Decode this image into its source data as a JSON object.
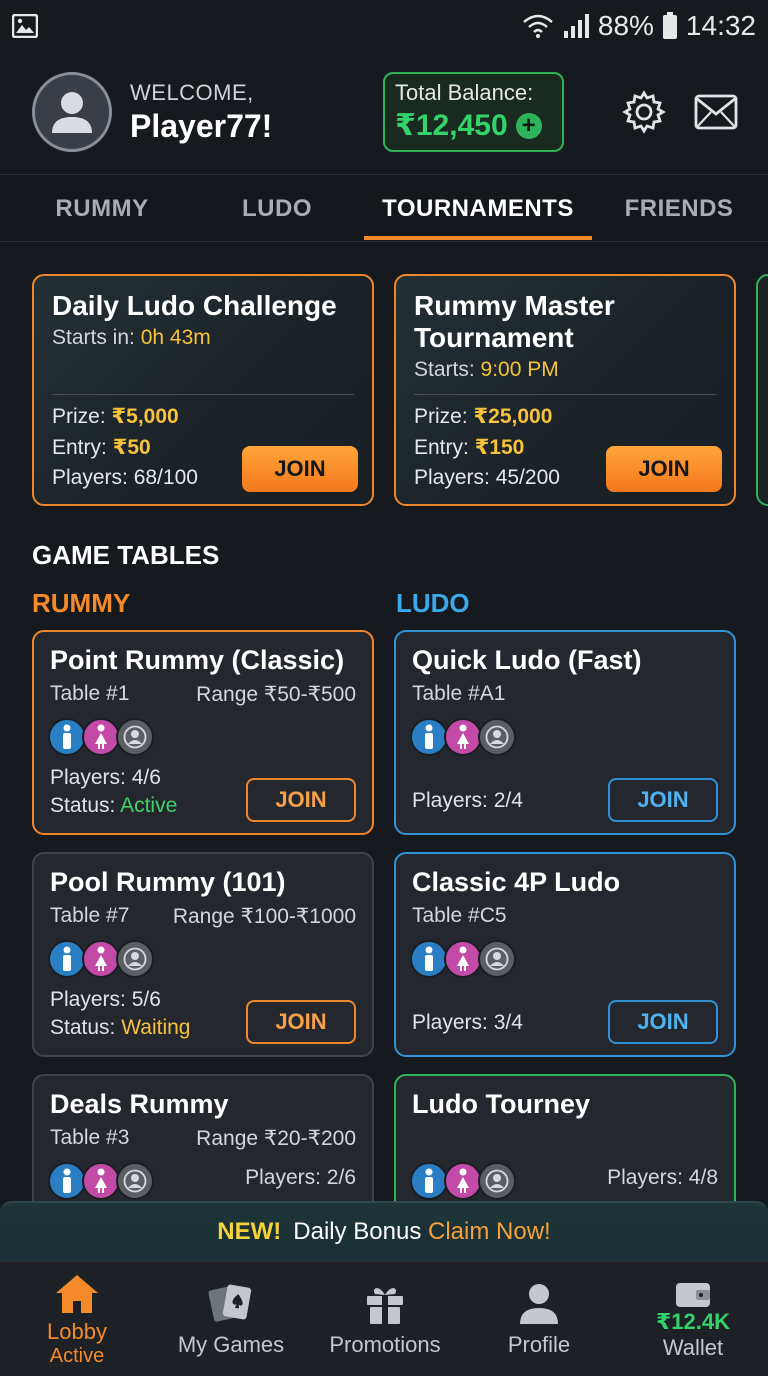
{
  "status_bar": {
    "battery": "88%",
    "time": "14:32"
  },
  "header": {
    "welcome": "WELCOME,",
    "player_name": "Player77!",
    "balance_label": "Total Balance:",
    "balance_amount": "₹12,450"
  },
  "tabs": [
    {
      "label": "RUMMY",
      "active": false
    },
    {
      "label": "LUDO",
      "active": false
    },
    {
      "label": "TOURNAMENTS",
      "active": true
    },
    {
      "label": "FRIENDS",
      "active": false
    }
  ],
  "tournaments": [
    {
      "title": "Daily Ludo Challenge",
      "starts_label": "Starts in:",
      "starts_value": "0h 43m",
      "prize_label": "Prize:",
      "prize": "₹5,000",
      "entry_label": "Entry:",
      "entry": "₹50",
      "players_label": "Players:",
      "players": "68/100",
      "join": "JOIN"
    },
    {
      "title": "Rummy Master Tournament",
      "starts_label": "Starts:",
      "starts_value": "9:00 PM",
      "prize_label": "Prize:",
      "prize": "₹25,000",
      "entry_label": "Entry:",
      "entry": "₹150",
      "players_label": "Players:",
      "players": "45/200",
      "join": "JOIN"
    }
  ],
  "section_title": "GAME TABLES",
  "columns": {
    "rummy": "RUMMY",
    "ludo": "LUDO"
  },
  "rummy_tables": [
    {
      "title": "Point Rummy (Classic)",
      "table": "Table #1",
      "range": "Range ₹50-₹500",
      "players": "Players: 4/6",
      "status_label": "Status:",
      "status": "Active",
      "join": "JOIN"
    },
    {
      "title": "Pool Rummy (101)",
      "table": "Table #7",
      "range": "Range ₹100-₹1000",
      "players": "Players: 5/6",
      "status_label": "Status:",
      "status": "Waiting",
      "join": "JOIN"
    },
    {
      "title": "Deals Rummy",
      "table": "Table #3",
      "range": "Range ₹20-₹200",
      "players": "Players: 2/6"
    }
  ],
  "ludo_tables": [
    {
      "title": "Quick Ludo (Fast)",
      "table": "Table #A1",
      "players": "Players: 2/4",
      "join": "JOIN"
    },
    {
      "title": "Classic 4P Ludo",
      "table": "Table #C5",
      "players": "Players: 3/4",
      "join": "JOIN"
    },
    {
      "title": "Ludo Tourney",
      "players": "Players: 4/8"
    }
  ],
  "banner": {
    "new": "NEW!",
    "text": "Daily Bonus",
    "claim": "Claim Now!"
  },
  "nav": {
    "lobby": "Lobby",
    "lobby_sub": "Active",
    "my_games": "My Games",
    "promotions": "Promotions",
    "profile": "Profile",
    "wallet_amount": "₹12.4K",
    "wallet": "Wallet"
  },
  "colors": {
    "accent": "#f58a2a",
    "green": "#34d26a",
    "blue": "#2f93d6",
    "gold": "#f6c33a",
    "background": "#16191d"
  }
}
